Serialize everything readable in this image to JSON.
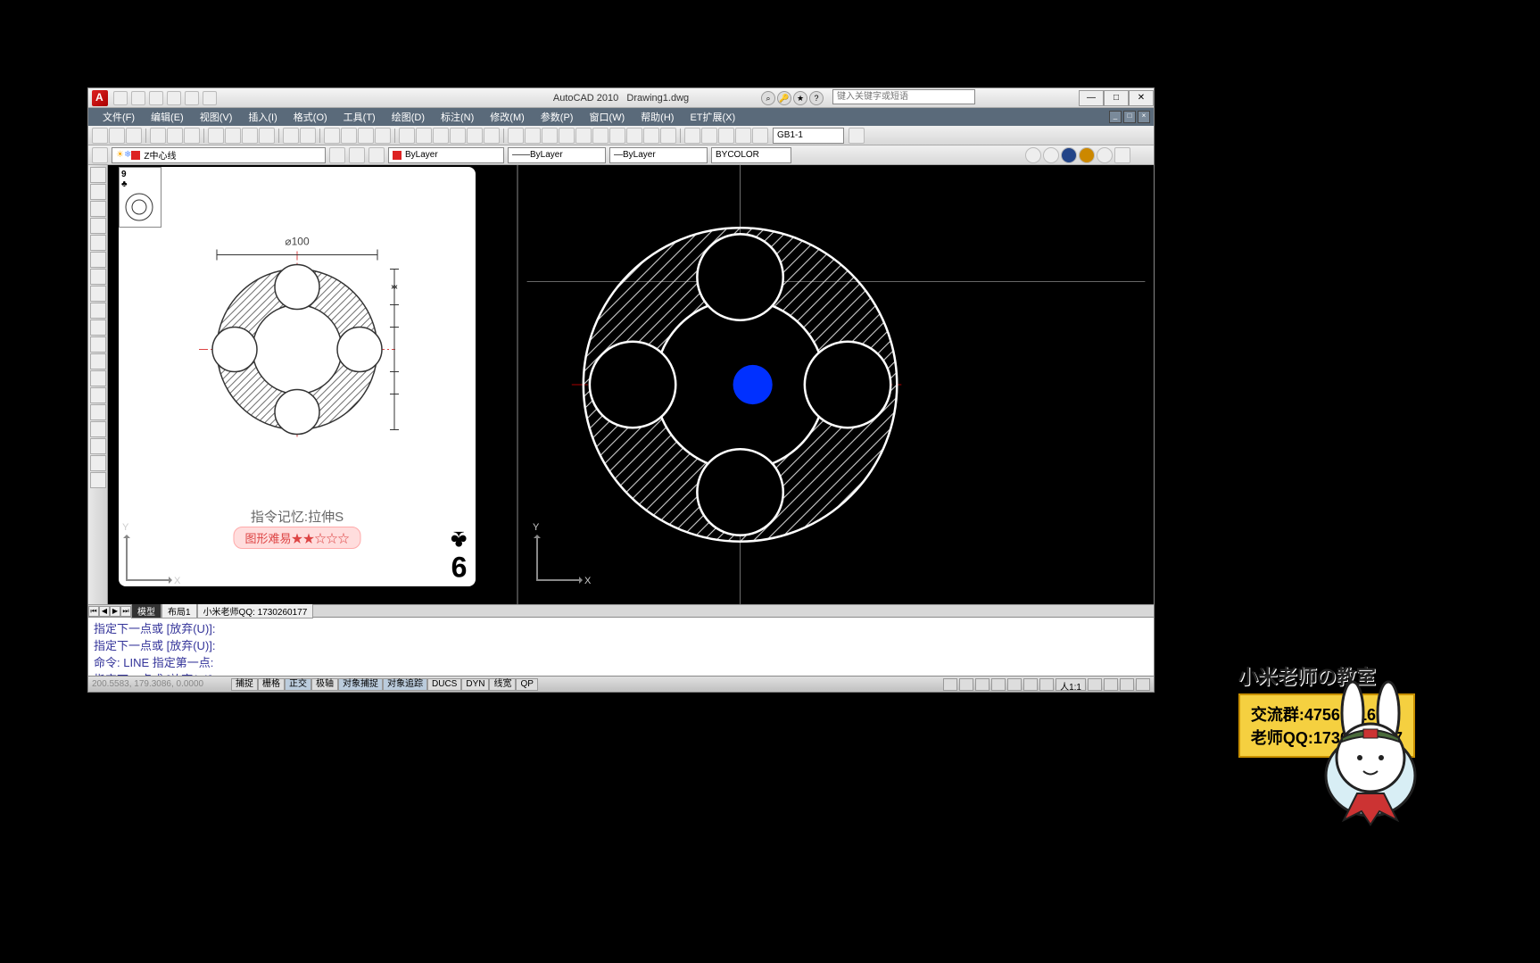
{
  "title": {
    "app": "AutoCAD 2010",
    "doc": "Drawing1.dwg"
  },
  "search_placeholder": "键入关键字或短语",
  "menu": [
    "文件(F)",
    "编辑(E)",
    "视图(V)",
    "插入(I)",
    "格式(O)",
    "工具(T)",
    "绘图(D)",
    "标注(N)",
    "修改(M)",
    "参数(P)",
    "窗口(W)",
    "帮助(H)",
    "ET扩展(X)"
  ],
  "layer": {
    "current": "Z中心线",
    "color": "#d22",
    "prop1": "ByLayer",
    "prop2": "ByLayer",
    "prop3": "ByLayer",
    "prop4": "BYCOLOR"
  },
  "linetype_combo": "GB1-1",
  "tabs": {
    "model": "模型",
    "layout1": "布局1",
    "layout2": "小米老师QQ: 1730260177"
  },
  "cmd": {
    "l1": "指定下一点或 [放弃(U)]:",
    "l2": "指定下一点或 [放弃(U)]:",
    "l3": "命令:  LINE 指定第一点:",
    "l4": "",
    "l5": "指定下一点或 [放弃(U)]:"
  },
  "status": {
    "coords": "200.5583, 179.3086, 0.0000",
    "toggles": [
      "捕捉",
      "栅格",
      "正交",
      "极轴",
      "对象捕捉",
      "对象追踪",
      "DUCS",
      "DYN",
      "线宽",
      "QP"
    ],
    "active": [
      2,
      4,
      5
    ],
    "scale": "人1:1"
  },
  "card": {
    "rank": "9",
    "suit": "♣",
    "dim": "⌀100",
    "memo": "指令记忆:拉伸S",
    "difficulty": "图形难易★★☆☆☆"
  },
  "overlay": {
    "title": "小米老师の教室",
    "line1": "交流群:475617165",
    "line2": "老师QQ:1730260177"
  },
  "ucs": {
    "x": "X",
    "y": "Y"
  }
}
